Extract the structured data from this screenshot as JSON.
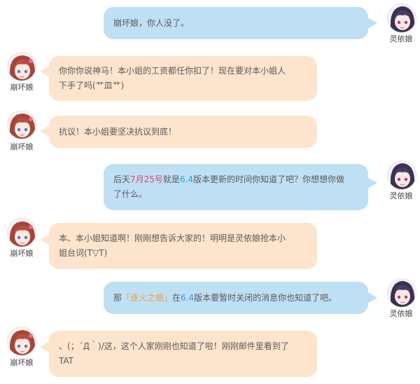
{
  "characters": {
    "linger": {
      "name": "灵依娘",
      "avatar_icon": "linger-avatar-icon"
    },
    "benghuai": {
      "name": "崩坏娘",
      "avatar_icon": "benghuai-avatar-icon"
    }
  },
  "colors": {
    "left_bubble": "#fde4cc",
    "right_bubble": "#bfdff5",
    "highlight_red": "#e0457b",
    "highlight_blue": "#2f9fd8",
    "highlight_orange": "#e8a23a"
  },
  "messages": [
    {
      "speaker": "灵依娘",
      "text": "崩坏娘，你人没了。"
    },
    {
      "speaker": "崩坏娘",
      "line1": "你你你说神马！本小姐的工资都任你扣了！现在要对本小姐人",
      "line2": "下手了吗(艹皿艹)"
    },
    {
      "speaker": "崩坏娘",
      "text": "抗议！本小姐要坚决抗议到底！"
    },
    {
      "speaker": "灵依娘",
      "l1_a": "后天",
      "l1_date": "7月25号",
      "l1_b": "就是",
      "l1_ver": "6.4",
      "l1_c": "版本更新的时间你知道了吧？你想想你做",
      "line2": "了什么。"
    },
    {
      "speaker": "崩坏娘",
      "line1": "本、本小姐知道啊！刚刚想告诉大家的！明明是灵依娘抢本小",
      "line2": "姐台词(T▽T)"
    },
    {
      "speaker": "灵依娘",
      "a": "那",
      "event": "「逐火之蛾」",
      "b": "在",
      "ver": "6.4",
      "c": "版本要暂时关闭的消息你也知道了吧。"
    },
    {
      "speaker": "崩坏娘",
      "line1": "、(；´Д｀)/这，这个人家刚刚也知道了啦！刚刚邮件里看到了",
      "line2": "TAT"
    }
  ]
}
